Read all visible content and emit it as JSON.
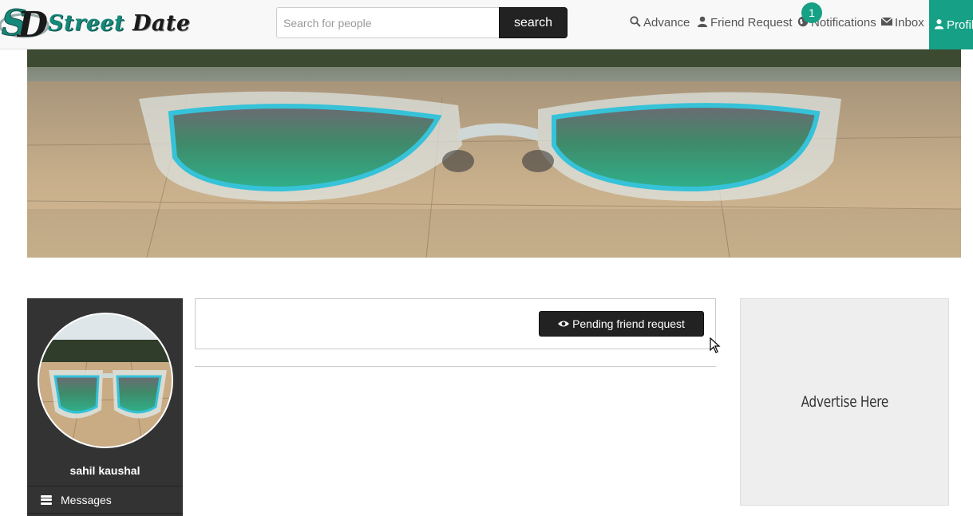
{
  "brand": {
    "name_part1": "Street",
    "name_part2": "Date",
    "monogram": "SD"
  },
  "search": {
    "placeholder": "Search for people",
    "button_label": "search"
  },
  "nav": {
    "advance": "Advance",
    "friend_request": "Friend Request",
    "notifications": "Notifications",
    "notifications_count": "1",
    "inbox": "Inbox",
    "profile": "Profile"
  },
  "sidebar": {
    "user_name": "sahil kaushal",
    "items": [
      {
        "label": "Messages",
        "icon": "menu-icon"
      }
    ]
  },
  "main": {
    "pending_button": "Pending friend request"
  },
  "ad": {
    "label": "Advertise Here"
  },
  "colors": {
    "accent": "#16a085",
    "dark": "#333333",
    "button": "#222222",
    "ad_bg": "#eeeeee"
  }
}
